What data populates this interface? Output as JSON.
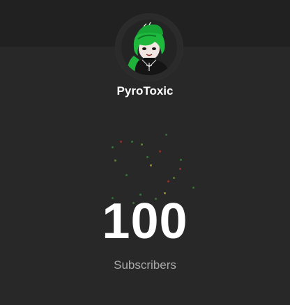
{
  "channel": {
    "name": "PyroToxic",
    "avatar_icon": "avatar-green-hair-character"
  },
  "stats": {
    "count": "100",
    "label": "Subscribers"
  },
  "colors": {
    "background": "#282828",
    "banner": "#212121",
    "name_text": "#ffffff",
    "label_text": "#aaaaaa",
    "confetti": [
      "#4caf50",
      "#e53935",
      "#fdd835",
      "#43a047",
      "#8bc34a"
    ]
  }
}
